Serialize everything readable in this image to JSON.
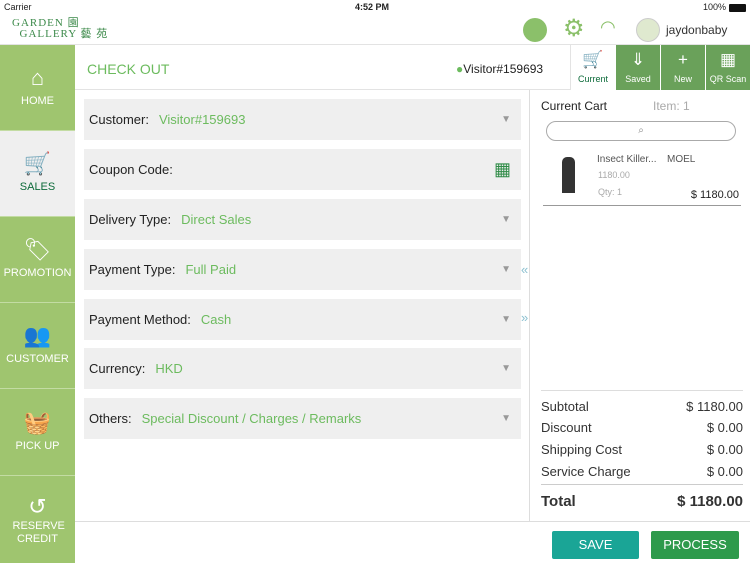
{
  "status": {
    "carrier": "Carrier",
    "time": "4:52 PM",
    "battery": "100%"
  },
  "header": {
    "logo_text": "GARDEN GALLERY",
    "username": "jaydonbaby"
  },
  "sidebar": {
    "items": [
      {
        "label": "HOME",
        "icon": "home-icon"
      },
      {
        "label": "SALES",
        "icon": "cart-icon"
      },
      {
        "label": "PROMOTION",
        "icon": "tag-icon"
      },
      {
        "label": "CUSTOMER",
        "icon": "users-icon"
      },
      {
        "label": "PICK UP",
        "icon": "basket-icon"
      },
      {
        "label": "RESERVE CREDIT",
        "icon": "undo-icon"
      }
    ]
  },
  "topbar": {
    "title": "CHECK OUT",
    "visitor": "Visitor#159693",
    "tabs": [
      {
        "label": "Current"
      },
      {
        "label": "Saved"
      },
      {
        "label": "New"
      },
      {
        "label": "QR Scan"
      }
    ]
  },
  "form": {
    "rows": [
      {
        "label": "Customer:",
        "value": "Visitor#159693"
      },
      {
        "label": "Coupon Code:",
        "value": ""
      },
      {
        "label": "Delivery Type:",
        "value": "Direct Sales"
      },
      {
        "label": "Payment Type:",
        "value": "Full Paid"
      },
      {
        "label": "Payment Method:",
        "value": "Cash"
      },
      {
        "label": "Currency:",
        "value": "HKD"
      },
      {
        "label": "Others:",
        "value": "Special Discount / Charges / Remarks"
      }
    ]
  },
  "cart": {
    "title": "Current Cart",
    "item_count": "Item: 1",
    "items": [
      {
        "name": "Insect Killer...",
        "brand": "MOEL",
        "unit_price": "1180.00",
        "qty": "Qty: 1",
        "total": "$ 1180.00"
      }
    ],
    "summary": [
      {
        "label": "Subtotal",
        "value": "$ 1180.00"
      },
      {
        "label": "Discount",
        "value": "$ 0.00"
      },
      {
        "label": "Shipping Cost",
        "value": "$ 0.00"
      },
      {
        "label": "Service Charge",
        "value": "$ 0.00"
      }
    ],
    "total_label": "Total",
    "total_value": "$ 1180.00"
  },
  "actions": {
    "save": "SAVE",
    "process": "PROCESS"
  },
  "colors": {
    "sidebar": "#9fc56f",
    "dark_green": "#0d6b3a",
    "value_green": "#6cbb5e",
    "save": "#1aa596",
    "process": "#2e9a4c"
  }
}
